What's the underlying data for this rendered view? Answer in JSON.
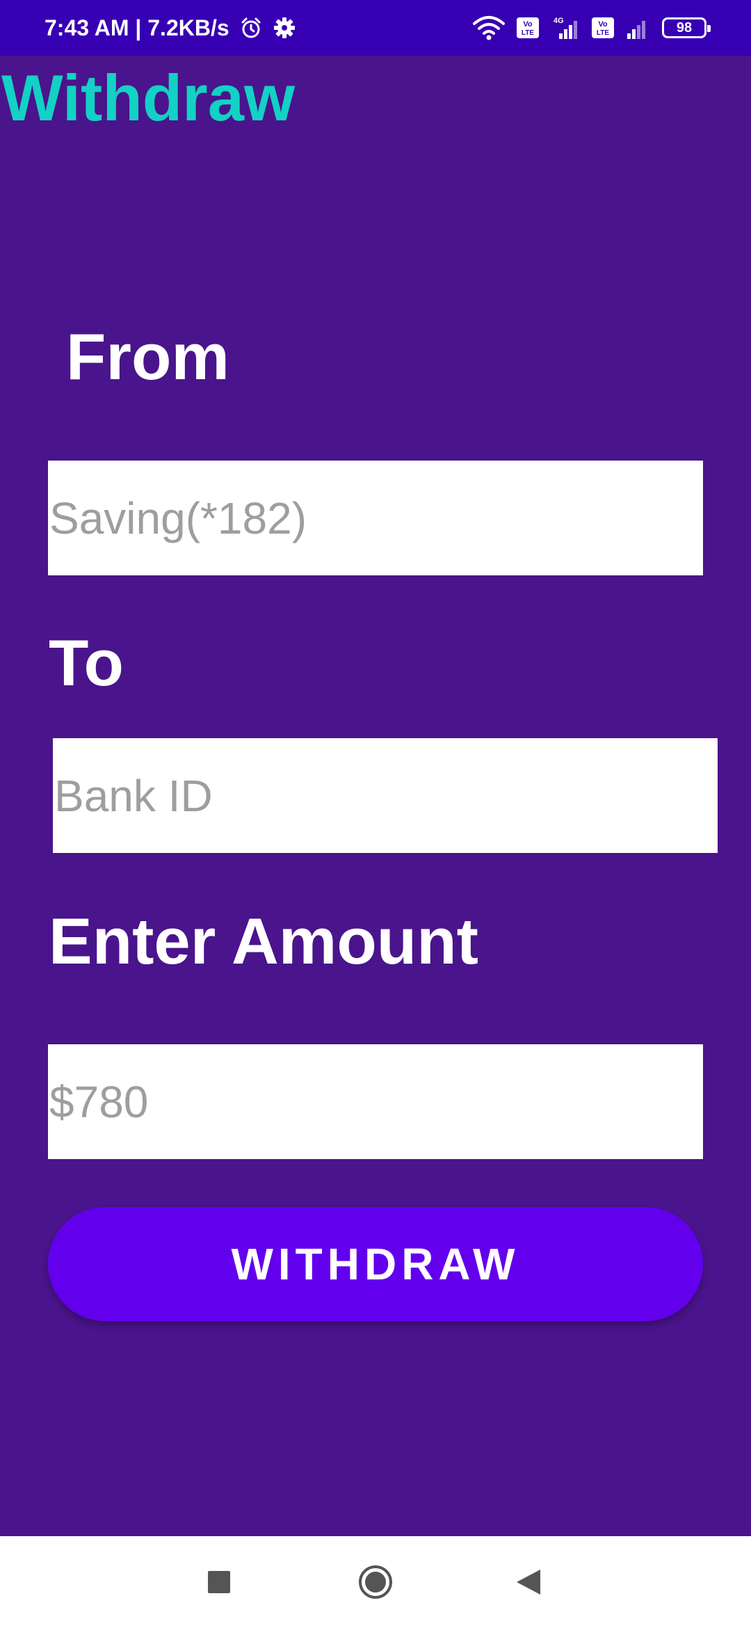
{
  "status_bar": {
    "time_speed": "7:43 AM | 7.2KB/s",
    "network_type": "4G",
    "volte_label_1": "Vo\nLTE",
    "volte_label_2": "Vo\nLTE",
    "battery_level": "98"
  },
  "app": {
    "title": "Withdraw"
  },
  "form": {
    "from_label": "From",
    "from_placeholder": "Saving(*182)",
    "to_label": "To",
    "to_placeholder": "Bank ID",
    "amount_label": "Enter Amount",
    "amount_placeholder": "$780",
    "submit_label": "WITHDRAW"
  },
  "nav_bar": {
    "icons": [
      "recents-square-icon",
      "home-circle-icon",
      "back-triangle-icon"
    ]
  },
  "colors": {
    "status_bar_bg": "#3700b3",
    "background": "#4a148c",
    "title": "#13d1c4",
    "button": "#6200ee",
    "placeholder": "#9e9e9e"
  }
}
